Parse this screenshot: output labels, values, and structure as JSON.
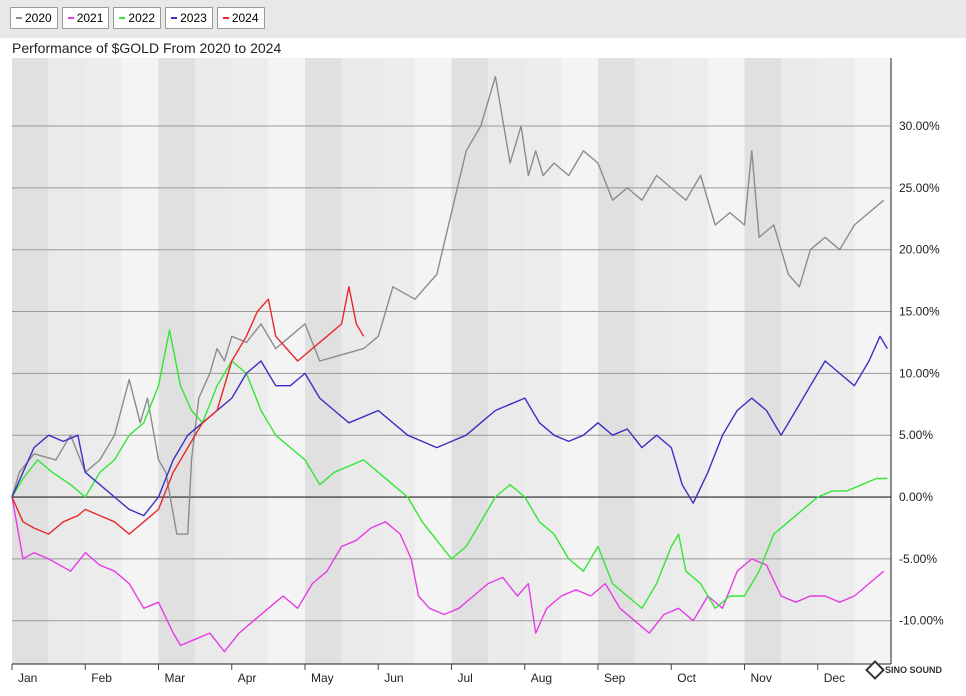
{
  "legend": [
    {
      "label": "2020",
      "color": "#8c8c8c"
    },
    {
      "label": "2021",
      "color": "#e63ce6"
    },
    {
      "label": "2022",
      "color": "#33e633"
    },
    {
      "label": "2023",
      "color": "#3a2fc4"
    },
    {
      "label": "2024",
      "color": "#e82828"
    }
  ],
  "watermark_text": "SINO SOUND",
  "chart_data": {
    "type": "line",
    "title": "Performance of $GOLD From 2020 to 2024",
    "xlabel": "",
    "ylabel": "",
    "months": [
      "Jan",
      "Feb",
      "Mar",
      "Apr",
      "May",
      "Jun",
      "Jul",
      "Aug",
      "Sep",
      "Oct",
      "Nov",
      "Dec"
    ],
    "y_ticks": [
      -10,
      -5,
      0,
      5,
      10,
      15,
      20,
      25,
      30
    ],
    "y_tick_labels": [
      "-10.00%",
      "-5.00%",
      "0.00%",
      "5.00%",
      "10.00%",
      "15.00%",
      "20.00%",
      "25.00%",
      "30.00%"
    ],
    "ylim": [
      -13.5,
      35.5
    ],
    "grid": true,
    "legend_position": "top-left",
    "x_unit": "months since start of year",
    "series": [
      {
        "name": "2020",
        "color": "#8c8c8c",
        "x": [
          0,
          0.1,
          0.3,
          0.6,
          0.8,
          1.0,
          1.2,
          1.4,
          1.6,
          1.75,
          1.85,
          2.0,
          2.1,
          2.25,
          2.4,
          2.45,
          2.55,
          2.7,
          2.8,
          2.9,
          3.0,
          3.2,
          3.4,
          3.6,
          3.8,
          4.0,
          4.2,
          4.5,
          4.8,
          5.0,
          5.2,
          5.5,
          5.8,
          6.0,
          6.2,
          6.4,
          6.6,
          6.8,
          6.95,
          7.05,
          7.15,
          7.25,
          7.4,
          7.6,
          7.8,
          8.0,
          8.2,
          8.4,
          8.6,
          8.8,
          9.0,
          9.2,
          9.4,
          9.6,
          9.8,
          10.0,
          10.1,
          10.2,
          10.4,
          10.6,
          10.75,
          10.9,
          11.1,
          11.3,
          11.5,
          11.7,
          11.9
        ],
        "y": [
          0,
          2,
          3.5,
          3,
          5,
          2,
          3,
          5,
          9.5,
          6,
          8,
          3,
          2,
          -3,
          -3,
          3,
          8,
          10,
          12,
          11,
          13,
          12.5,
          14,
          12,
          13,
          14,
          11,
          11.5,
          12,
          13,
          17,
          16,
          18,
          23,
          28,
          30,
          34,
          27,
          30,
          26,
          28,
          26,
          27,
          26,
          28,
          27,
          24,
          25,
          24,
          26,
          25,
          24,
          26,
          22,
          23,
          22,
          28,
          21,
          22,
          18,
          17,
          20,
          21,
          20,
          22,
          23,
          24
        ]
      },
      {
        "name": "2021",
        "color": "#e63ce6",
        "x": [
          0,
          0.15,
          0.3,
          0.5,
          0.8,
          1.0,
          1.2,
          1.4,
          1.6,
          1.8,
          2.0,
          2.2,
          2.3,
          2.5,
          2.7,
          2.9,
          3.1,
          3.3,
          3.5,
          3.7,
          3.9,
          4.1,
          4.3,
          4.5,
          4.7,
          4.9,
          5.1,
          5.3,
          5.45,
          5.55,
          5.7,
          5.9,
          6.1,
          6.3,
          6.5,
          6.7,
          6.9,
          7.05,
          7.15,
          7.3,
          7.5,
          7.7,
          7.9,
          8.1,
          8.3,
          8.5,
          8.7,
          8.9,
          9.1,
          9.3,
          9.5,
          9.7,
          9.9,
          10.1,
          10.3,
          10.5,
          10.7,
          10.9,
          11.1,
          11.3,
          11.5,
          11.7,
          11.9
        ],
        "y": [
          0,
          -5,
          -4.5,
          -5,
          -6,
          -4.5,
          -5.5,
          -6,
          -7,
          -9,
          -8.5,
          -11,
          -12,
          -11.5,
          -11,
          -12.5,
          -11,
          -10,
          -9,
          -8,
          -9,
          -7,
          -6,
          -4,
          -3.5,
          -2.5,
          -2,
          -3,
          -5,
          -8,
          -9,
          -9.5,
          -9,
          -8,
          -7,
          -6.5,
          -8,
          -7,
          -11,
          -9,
          -8,
          -7.5,
          -8,
          -7,
          -9,
          -10,
          -11,
          -9.5,
          -9,
          -10,
          -8,
          -9,
          -6,
          -5,
          -5.5,
          -8,
          -8.5,
          -8,
          -8,
          -8.5,
          -8,
          -7,
          -6
        ]
      },
      {
        "name": "2022",
        "color": "#33e633",
        "x": [
          0,
          0.15,
          0.35,
          0.55,
          0.8,
          1.0,
          1.2,
          1.4,
          1.6,
          1.8,
          2.0,
          2.15,
          2.3,
          2.45,
          2.6,
          2.8,
          3.0,
          3.2,
          3.4,
          3.6,
          3.8,
          4.0,
          4.2,
          4.4,
          4.6,
          4.8,
          5.0,
          5.2,
          5.4,
          5.6,
          5.8,
          6.0,
          6.2,
          6.4,
          6.6,
          6.8,
          7.0,
          7.2,
          7.4,
          7.6,
          7.8,
          8.0,
          8.2,
          8.4,
          8.6,
          8.8,
          9.0,
          9.1,
          9.2,
          9.4,
          9.6,
          9.8,
          10.0,
          10.2,
          10.4,
          10.6,
          10.8,
          11.0,
          11.2,
          11.4,
          11.6,
          11.8,
          11.95
        ],
        "y": [
          0,
          1.5,
          3,
          2,
          1,
          0,
          2,
          3,
          5,
          6,
          9,
          13.5,
          9,
          7,
          6,
          9,
          11,
          10,
          7,
          5,
          4,
          3,
          1,
          2,
          2.5,
          3,
          2,
          1,
          0,
          -2,
          -3.5,
          -5,
          -4,
          -2,
          0,
          1,
          0,
          -2,
          -3,
          -5,
          -6,
          -4,
          -7,
          -8,
          -9,
          -7,
          -4,
          -3,
          -6,
          -7,
          -9,
          -8,
          -8,
          -6,
          -3,
          -2,
          -1,
          0,
          0.5,
          0.5,
          1,
          1.5,
          1.5
        ]
      },
      {
        "name": "2023",
        "color": "#3a2fc4",
        "x": [
          0,
          0.15,
          0.3,
          0.5,
          0.7,
          0.9,
          1.0,
          1.2,
          1.4,
          1.6,
          1.8,
          2.0,
          2.2,
          2.4,
          2.6,
          2.8,
          3.0,
          3.2,
          3.4,
          3.6,
          3.8,
          4.0,
          4.2,
          4.4,
          4.6,
          4.8,
          5.0,
          5.2,
          5.4,
          5.6,
          5.8,
          6.0,
          6.2,
          6.4,
          6.6,
          6.8,
          7.0,
          7.2,
          7.4,
          7.6,
          7.8,
          8.0,
          8.2,
          8.4,
          8.6,
          8.8,
          9.0,
          9.15,
          9.3,
          9.5,
          9.7,
          9.9,
          10.1,
          10.3,
          10.5,
          10.7,
          10.9,
          11.1,
          11.3,
          11.5,
          11.7,
          11.85,
          11.95
        ],
        "y": [
          0,
          2,
          4,
          5,
          4.5,
          5,
          2,
          1,
          0,
          -1,
          -1.5,
          0,
          3,
          5,
          6,
          7,
          8,
          10,
          11,
          9,
          9,
          10,
          8,
          7,
          6,
          6.5,
          7,
          6,
          5,
          4.5,
          4,
          4.5,
          5,
          6,
          7,
          7.5,
          8,
          6,
          5,
          4.5,
          5,
          6,
          5,
          5.5,
          4,
          5,
          4,
          1,
          -0.5,
          2,
          5,
          7,
          8,
          7,
          5,
          7,
          9,
          11,
          10,
          9,
          11,
          13,
          12
        ]
      },
      {
        "name": "2024",
        "color": "#e82828",
        "x": [
          0,
          0.15,
          0.3,
          0.5,
          0.7,
          0.9,
          1.0,
          1.2,
          1.4,
          1.6,
          1.8,
          2.0,
          2.2,
          2.4,
          2.6,
          2.8,
          3.0,
          3.2,
          3.35,
          3.5,
          3.6,
          3.75,
          3.9,
          4.1,
          4.3,
          4.5,
          4.6,
          4.7,
          4.8
        ],
        "y": [
          0,
          -2,
          -2.5,
          -3,
          -2,
          -1.5,
          -1,
          -1.5,
          -2,
          -3,
          -2,
          -1,
          2,
          4,
          6,
          7,
          11,
          13,
          15,
          16,
          13,
          12,
          11,
          12,
          13,
          14,
          17,
          14,
          13
        ]
      }
    ]
  }
}
